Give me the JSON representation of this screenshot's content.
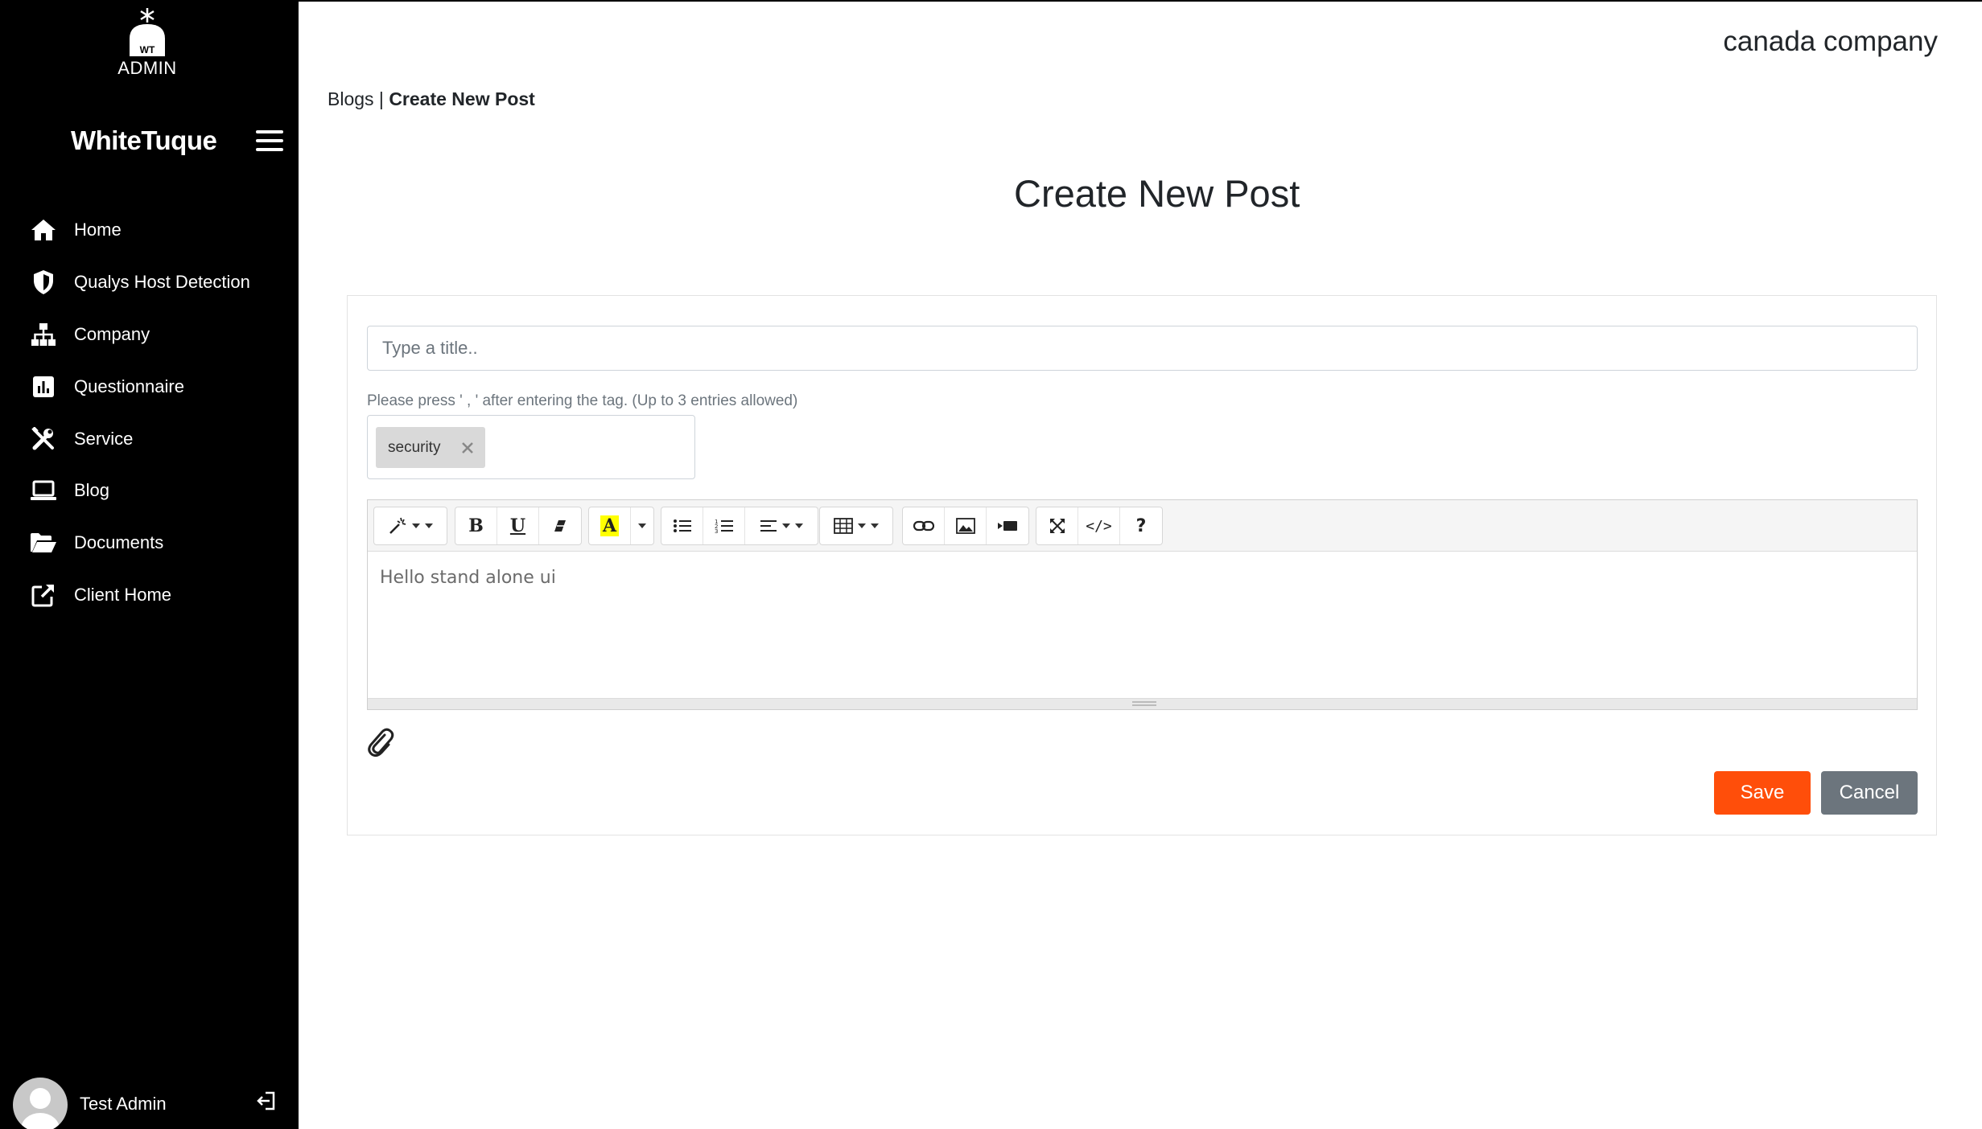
{
  "sidebar": {
    "logo_badge": "WT",
    "logo_text": "ADMIN",
    "brand": "WhiteTuque",
    "items": [
      {
        "label": "Home",
        "icon": "home-icon"
      },
      {
        "label": "Qualys Host Detection",
        "icon": "shield-icon"
      },
      {
        "label": "Company",
        "icon": "sitemap-icon"
      },
      {
        "label": "Questionnaire",
        "icon": "chart-square-icon"
      },
      {
        "label": "Service",
        "icon": "tools-icon"
      },
      {
        "label": "Blog",
        "icon": "laptop-icon"
      },
      {
        "label": "Documents",
        "icon": "folder-open-icon"
      },
      {
        "label": "Client Home",
        "icon": "external-link-icon"
      }
    ],
    "user_name": "Test Admin"
  },
  "header": {
    "company": "canada company"
  },
  "breadcrumb": {
    "parent": "Blogs",
    "separator": " | ",
    "current": "Create New Post"
  },
  "page": {
    "title": "Create New Post"
  },
  "form": {
    "title_placeholder": "Type a title..",
    "title_value": "",
    "tag_hint": "Please press ' , ' after entering the tag. (Up to 3 entries allowed)",
    "tags": [
      "security"
    ],
    "editor_content": "Hello stand alone ui",
    "save_label": "Save",
    "cancel_label": "Cancel"
  },
  "toolbar": {
    "bold": "B",
    "underline": "U",
    "highlight": "A",
    "code": "</>",
    "help": "?"
  },
  "colors": {
    "sidebar_bg": "#000000",
    "save_button": "#ff4e0a",
    "cancel_button": "#6c757d",
    "highlight": "#ffff00"
  }
}
